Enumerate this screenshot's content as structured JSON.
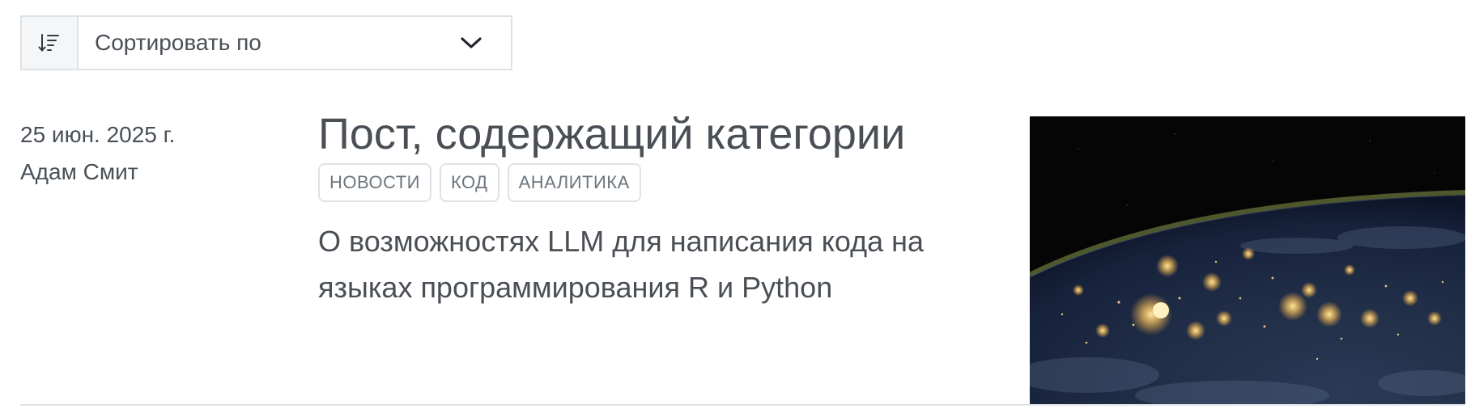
{
  "sort": {
    "icon": "sort-descending-icon",
    "label": "Сортировать по",
    "chevron_icon": "chevron-down-icon"
  },
  "posts": [
    {
      "date": "25 июн. 2025 г.",
      "author": "Адам Смит",
      "title": "Пост, содержащий категории",
      "categories": [
        "НОВОСТИ",
        "КОД",
        "АНАЛИТИКА"
      ],
      "description": "О возможностях LLM для написания кода на языках программирования R и Python",
      "thumbnail": "earth-at-night-image"
    }
  ],
  "colors": {
    "text": "#4a4f55",
    "muted": "#6c757d",
    "border": "#dee2e6",
    "icon_bg": "#f5f6f8"
  }
}
